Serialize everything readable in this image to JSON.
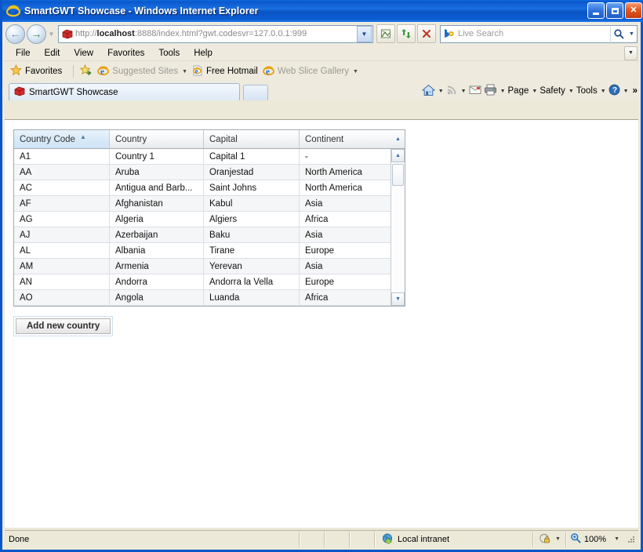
{
  "window": {
    "title": "SmartGWT Showcase - Windows Internet Explorer",
    "icon": "ie-logo-icon",
    "minimize_label": "Minimize",
    "maximize_label": "Maximize",
    "close_label": "Close"
  },
  "navigation": {
    "back_label": "Back",
    "forward_label": "Forward",
    "history_label": "Recent Pages",
    "url_prefix": "http://",
    "url_host": "localhost",
    "url_rest": ":8888/index.html?gwt.codesvr=127.0.0.1:999",
    "url_full": "http://localhost:8888/index.html?gwt.codesvr=127.0.0.1:999",
    "compatibility_label": "Compatibility View",
    "refresh_label": "Refresh",
    "stop_label": "Stop"
  },
  "search": {
    "placeholder": "Live Search",
    "provider": "Bing",
    "go_label": "Search",
    "dropdown_label": "Search Options"
  },
  "menu": {
    "items": [
      {
        "label": "File"
      },
      {
        "label": "Edit"
      },
      {
        "label": "View"
      },
      {
        "label": "Favorites"
      },
      {
        "label": "Tools"
      },
      {
        "label": "Help"
      }
    ]
  },
  "favorites_bar": {
    "favorites_label": "Favorites",
    "items": [
      {
        "label": "Suggested Sites",
        "dimmed": true,
        "has_caret": true
      },
      {
        "label": "Free Hotmail",
        "dimmed": false,
        "has_caret": false
      },
      {
        "label": "Web Slice Gallery",
        "dimmed": true,
        "has_caret": true
      }
    ]
  },
  "tabs": {
    "active": {
      "label": "SmartGWT Showcase"
    },
    "new_tab_label": "New Tab"
  },
  "command_bar": {
    "home_label": "Home",
    "feeds_label": "Feeds",
    "mail_label": "Read Mail",
    "print_label": "Print",
    "items": [
      {
        "label": "Page"
      },
      {
        "label": "Safety"
      },
      {
        "label": "Tools"
      }
    ],
    "help_label": "Help",
    "overflow_label": "More"
  },
  "grid": {
    "columns": [
      {
        "label": "Country Code",
        "sorted": true,
        "sort_dir": "ascending"
      },
      {
        "label": "Country",
        "sorted": false
      },
      {
        "label": "Capital",
        "sorted": false
      },
      {
        "label": "Continent",
        "sorted": false
      }
    ],
    "rows": [
      {
        "code": "A1",
        "country": "Country 1",
        "capital": "Capital 1",
        "continent": "-"
      },
      {
        "code": "AA",
        "country": "Aruba",
        "capital": "Oranjestad",
        "continent": "North America"
      },
      {
        "code": "AC",
        "country": "Antigua and Barb...",
        "capital": "Saint Johns",
        "continent": "North America"
      },
      {
        "code": "AF",
        "country": "Afghanistan",
        "capital": "Kabul",
        "continent": "Asia"
      },
      {
        "code": "AG",
        "country": "Algeria",
        "capital": "Algiers",
        "continent": "Africa"
      },
      {
        "code": "AJ",
        "country": "Azerbaijan",
        "capital": "Baku",
        "continent": "Asia"
      },
      {
        "code": "AL",
        "country": "Albania",
        "capital": "Tirane",
        "continent": "Europe"
      },
      {
        "code": "AM",
        "country": "Armenia",
        "capital": "Yerevan",
        "continent": "Asia"
      },
      {
        "code": "AN",
        "country": "Andorra",
        "capital": "Andorra la Vella",
        "continent": "Europe"
      },
      {
        "code": "AO",
        "country": "Angola",
        "capital": "Luanda",
        "continent": "Africa"
      }
    ],
    "scroll_up_label": "Scroll Up",
    "scroll_down_label": "Scroll Down"
  },
  "actions": {
    "add_new_country": "Add new country"
  },
  "status": {
    "text": "Done",
    "zone": "Local intranet",
    "protected_mode_label": "Protected Mode",
    "zoom": "100%"
  },
  "colors": {
    "titlebar_blue": "#0a56c8",
    "chrome_beige": "#ece9d8",
    "sorted_header": "#d8eaf8",
    "row_alt": "#f5f6f7",
    "accent_link": "#16478c"
  }
}
